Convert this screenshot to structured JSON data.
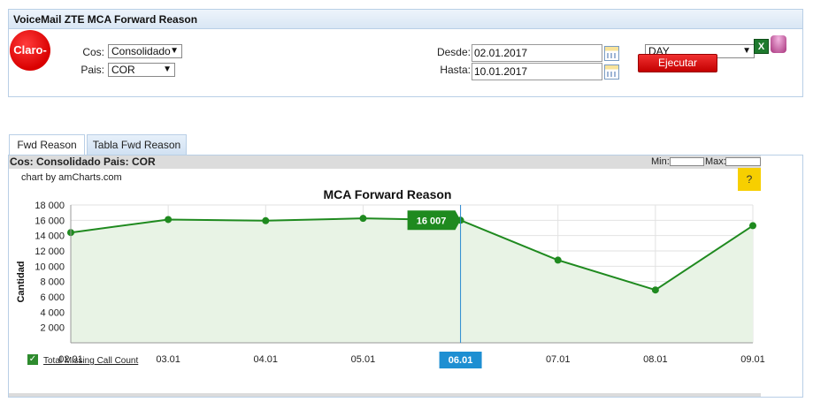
{
  "header": {
    "title": "VoiceMail ZTE MCA Forward Reason",
    "logo_text": "Claro-",
    "cos_label": "Cos:",
    "cos_value": "Consolidado",
    "pais_label": "Pais:",
    "pais_value": "COR",
    "desde_label": "Desde:",
    "desde_value": "02.01.2017",
    "hasta_label": "Hasta:",
    "hasta_value": "10.01.2017",
    "granularity_value": "DAY",
    "ejecutar_label": "Ejecutar",
    "excel_icon_text": "X"
  },
  "tabs": [
    {
      "label": "Fwd Reason",
      "active": true
    },
    {
      "label": "Tabla Fwd Reason",
      "active": false
    }
  ],
  "content": {
    "subheader": "Cos: Consolidado Pais: COR",
    "min_label": "Min:",
    "max_label": "Max:",
    "credit": "chart by amCharts.com",
    "help_label": "?"
  },
  "chart_data": {
    "type": "area",
    "title": "MCA Forward Reason",
    "ylabel": "Cantidad",
    "xlabel": "",
    "x": [
      "02.01",
      "03.01",
      "04.01",
      "05.01",
      "06.01",
      "07.01",
      "08.01",
      "09.01"
    ],
    "series": [
      {
        "name": "Total Missing Call Count",
        "values": [
          14400,
          16100,
          15950,
          16250,
          16007,
          10800,
          6900,
          15300
        ],
        "color": "#1f8a1f"
      }
    ],
    "ylim": [
      0,
      18000
    ],
    "yticks": [
      "2 000",
      "4 000",
      "6 000",
      "8 000",
      "10 000",
      "12 000",
      "14 000",
      "16 000",
      "18 000"
    ],
    "ytick_values": [
      2000,
      4000,
      6000,
      8000,
      10000,
      12000,
      14000,
      16000,
      18000
    ],
    "grid": true,
    "cursor_category": "06.01",
    "cursor_value_label": "16 007",
    "fill_color": "#e8f3e5"
  }
}
